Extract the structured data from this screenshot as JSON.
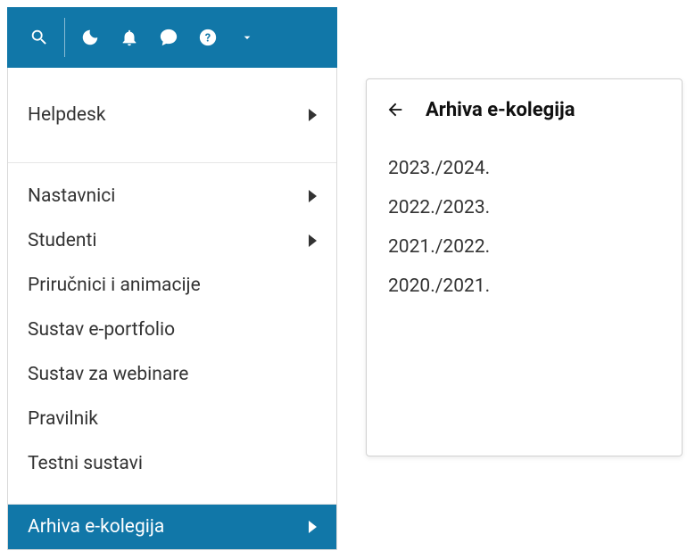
{
  "toolbar": {
    "icons": [
      "search",
      "moon",
      "bell",
      "speech",
      "help",
      "chevron-down"
    ]
  },
  "menu": {
    "items": [
      {
        "label": "Helpdesk",
        "hasSubmenu": true
      },
      {
        "label": "Nastavnici",
        "hasSubmenu": true
      },
      {
        "label": "Studenti",
        "hasSubmenu": true
      },
      {
        "label": "Priručnici i animacije",
        "hasSubmenu": false
      },
      {
        "label": "Sustav e-portfolio",
        "hasSubmenu": false
      },
      {
        "label": "Sustav za webinare",
        "hasSubmenu": false
      },
      {
        "label": "Pravilnik",
        "hasSubmenu": false
      },
      {
        "label": "Testni sustavi",
        "hasSubmenu": false
      },
      {
        "label": "Arhiva e-kolegija",
        "hasSubmenu": true,
        "active": true
      }
    ]
  },
  "submenu": {
    "title": "Arhiva e-kolegija",
    "items": [
      "2023./2024.",
      "2022./2023.",
      "2021./2022.",
      "2020./2021."
    ]
  },
  "colors": {
    "brand": "#1177a8"
  }
}
